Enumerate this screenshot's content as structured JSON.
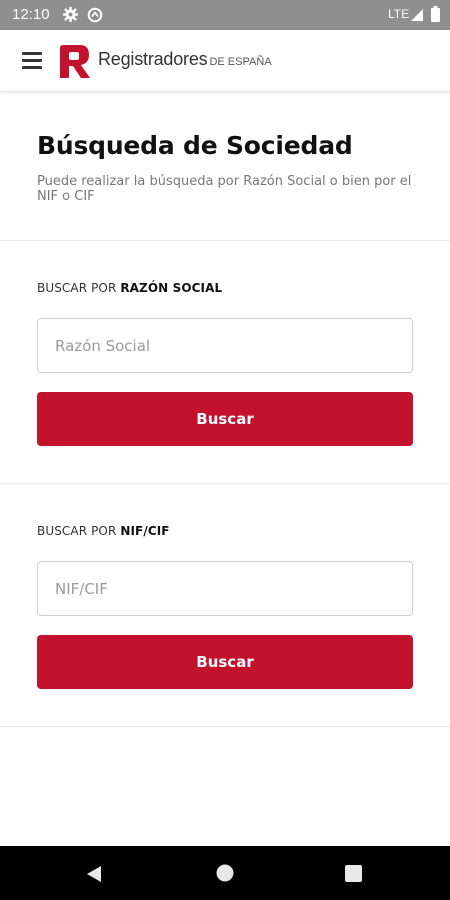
{
  "status_bar": {
    "time": "12:10",
    "network": "LTE",
    "icons": [
      "gear-icon",
      "sync-icon",
      "signal-icon",
      "battery-icon"
    ]
  },
  "header": {
    "brand_main": "Registradores",
    "brand_sub": "DE ESPAÑA",
    "menu_icon": "hamburger-menu-icon",
    "brand_color": "#c2122d"
  },
  "main": {
    "title": "Búsqueda de Sociedad",
    "description": "Puede realizar la búsqueda por Razón Social o bien por el NIF o CIF",
    "sections": [
      {
        "label_prefix": "BUSCAR POR",
        "label_emphasis": "RAZÓN SOCIAL",
        "input_placeholder": "Razón Social",
        "input_value": "",
        "button_label": "Buscar"
      },
      {
        "label_prefix": "BUSCAR POR",
        "label_emphasis": "NIF/CIF",
        "input_placeholder": "NIF/CIF",
        "input_value": "",
        "button_label": "Buscar"
      }
    ]
  },
  "nav_bar": {
    "icons": [
      "back-icon",
      "home-icon",
      "recents-icon"
    ]
  },
  "colors": {
    "accent": "#c2122d",
    "status_bar": "#8f8f8f",
    "nav_bar": "#000000"
  }
}
